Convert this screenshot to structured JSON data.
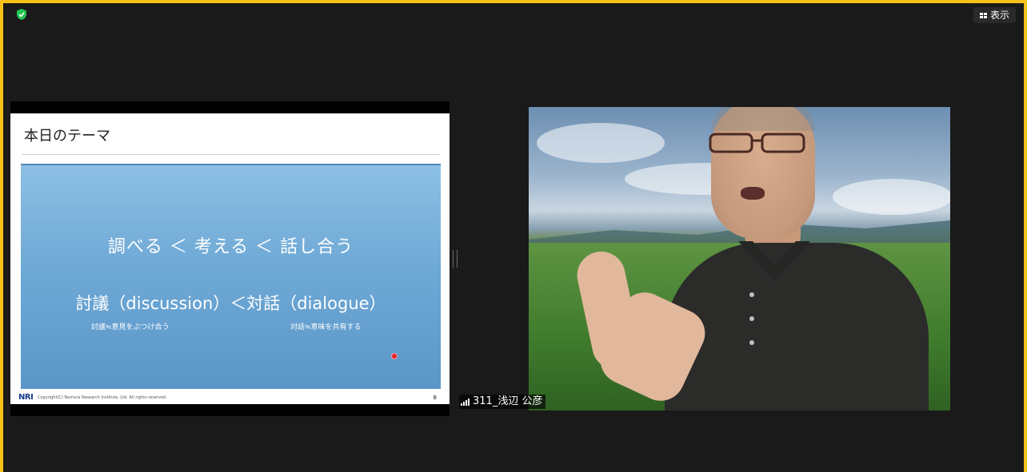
{
  "top_right": {
    "view_label": "表示"
  },
  "shared_slide": {
    "title": "本日のテーマ",
    "main_line": "調べる  ＜  考える  ＜  話し合う",
    "second_line": "討議（discussion）＜対話（dialogue）",
    "note_left": "討議≒意見をぶつけ合う",
    "note_right": "対話≒意味を共有する",
    "logo": "NRI",
    "copyright": "Copyright(C) Nomura Research Institute, Ltd. All rights reserved.",
    "page_number": "8"
  },
  "participant": {
    "name_label": "311_浅辺 公彦"
  },
  "colors": {
    "frame": "#f6c21a",
    "background": "#1a1a1a",
    "security_shield": "#23c552"
  },
  "icons": [
    "shield-check-icon",
    "grid-view-icon",
    "signal-bars-icon"
  ]
}
